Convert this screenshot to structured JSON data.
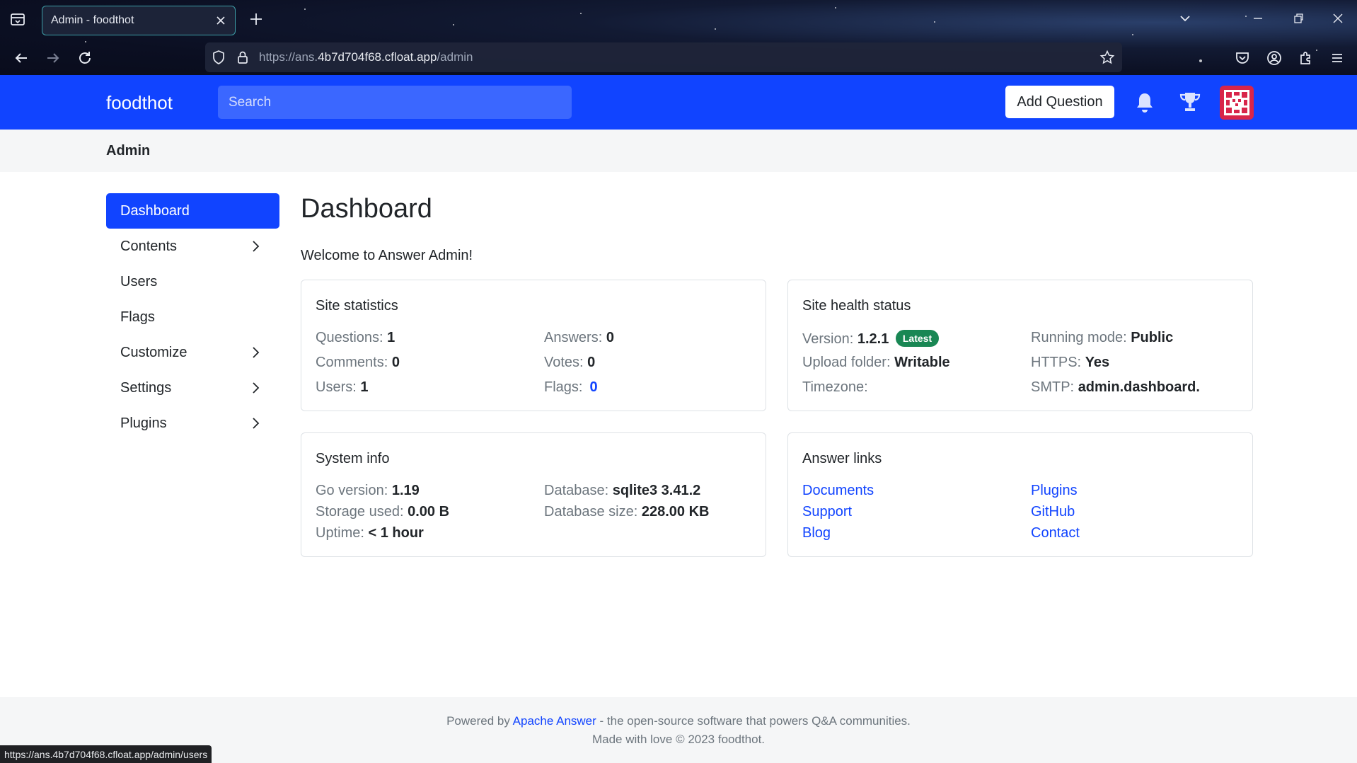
{
  "browser": {
    "tab_title": "Admin - foodthot",
    "url_prefix": "https://ans.",
    "url_host": "4b7d704f68.cfloat.app",
    "url_path": "/admin",
    "status_url": "https://ans.4b7d704f68.cfloat.app/admin/users"
  },
  "header": {
    "brand": "foodthot",
    "search_placeholder": "Search",
    "add_question_label": "Add Question"
  },
  "subbar": {
    "title": "Admin"
  },
  "sidebar": {
    "items": [
      {
        "label": "Dashboard",
        "active": true,
        "has_children": false
      },
      {
        "label": "Contents",
        "active": false,
        "has_children": true
      },
      {
        "label": "Users",
        "active": false,
        "has_children": false
      },
      {
        "label": "Flags",
        "active": false,
        "has_children": false
      },
      {
        "label": "Customize",
        "active": false,
        "has_children": true
      },
      {
        "label": "Settings",
        "active": false,
        "has_children": true
      },
      {
        "label": "Plugins",
        "active": false,
        "has_children": true
      }
    ]
  },
  "main": {
    "title": "Dashboard",
    "welcome": "Welcome to Answer Admin!",
    "site_statistics": {
      "title": "Site statistics",
      "questions_label": "Questions:",
      "questions": "1",
      "answers_label": "Answers:",
      "answers": "0",
      "comments_label": "Comments:",
      "comments": "0",
      "votes_label": "Votes:",
      "votes": "0",
      "users_label": "Users:",
      "users": "1",
      "flags_label": "Flags:",
      "flags": "0"
    },
    "site_health": {
      "title": "Site health status",
      "version_label": "Version:",
      "version": "1.2.1",
      "version_badge": "Latest",
      "running_mode_label": "Running mode:",
      "running_mode": "Public",
      "upload_folder_label": "Upload folder:",
      "upload_folder": "Writable",
      "https_label": "HTTPS:",
      "https": "Yes",
      "timezone_label": "Timezone:",
      "timezone": "",
      "smtp_label": "SMTP:",
      "smtp": "admin.dashboard."
    },
    "system_info": {
      "title": "System info",
      "go_version_label": "Go version:",
      "go_version": "1.19",
      "database_label": "Database:",
      "database": "sqlite3 3.41.2",
      "storage_label": "Storage used:",
      "storage": "0.00 B",
      "db_size_label": "Database size:",
      "db_size": "228.00 KB",
      "uptime_label": "Uptime:",
      "uptime": "< 1 hour"
    },
    "answer_links": {
      "title": "Answer links",
      "documents": "Documents",
      "plugins": "Plugins",
      "support": "Support",
      "github": "GitHub",
      "blog": "Blog",
      "contact": "Contact"
    }
  },
  "footer": {
    "powered_by": "Powered by",
    "apache_answer": "Apache Answer",
    "tagline": "- the open-source software that powers Q&A communities.",
    "made_with": "Made with love © 2023 foodthot."
  },
  "colors": {
    "brand_blue": "#1144ff",
    "badge_green": "#198754"
  }
}
